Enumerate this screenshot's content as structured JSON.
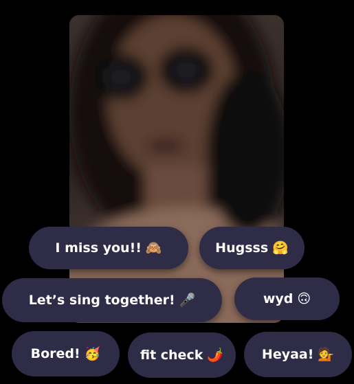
{
  "replies": [
    {
      "label": "I miss you!!",
      "emoji": "🙈",
      "icon": "monkey-icon"
    },
    {
      "label": "Hugsss",
      "emoji": "🤗",
      "icon": "hugging-face-icon"
    },
    {
      "label": "Let’s sing together!",
      "emoji": "🎤",
      "icon": "microphone-icon"
    },
    {
      "label": "wyd",
      "emoji": "🙃",
      "icon": "upside-down-face-icon"
    },
    {
      "label": "Bored!",
      "emoji": "🥳",
      "icon": "party-face-icon"
    },
    {
      "label": "fit check",
      "emoji": "🌶️",
      "icon": "chili-pepper-icon"
    },
    {
      "label": "Heyaa!",
      "emoji": "💁",
      "icon": "tipping-hand-icon"
    }
  ],
  "colors": {
    "chip_background": "#2e2c47",
    "chip_text": "#ffffff",
    "page_background": "#000000"
  }
}
